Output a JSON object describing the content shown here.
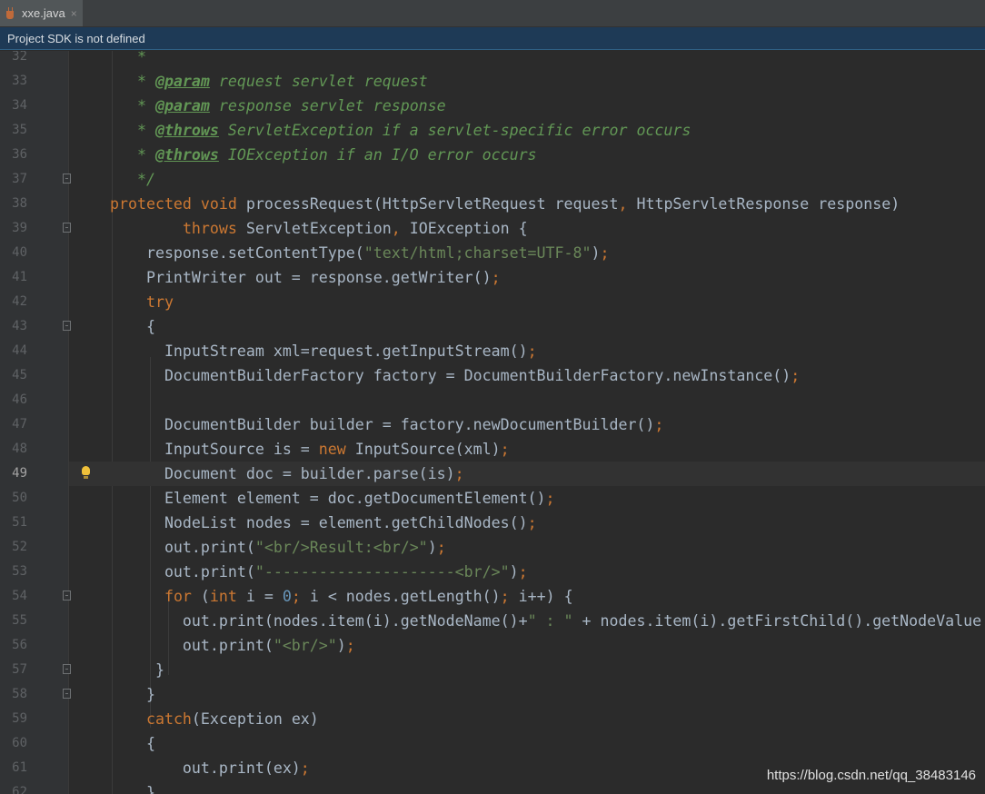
{
  "tab": {
    "filename": "xxe.java",
    "close": "×"
  },
  "notice": "Project SDK is not defined",
  "current_line": 49,
  "watermark": "https://blog.csdn.net/qq_38483146",
  "lines": [
    {
      "n": 32,
      "tokens": [
        [
          "doc",
          "   *"
        ]
      ]
    },
    {
      "n": 33,
      "tokens": [
        [
          "doc",
          "   * "
        ],
        [
          "doctag",
          "@param"
        ],
        [
          "doc",
          " request servlet request"
        ]
      ]
    },
    {
      "n": 34,
      "tokens": [
        [
          "doc",
          "   * "
        ],
        [
          "doctag",
          "@param"
        ],
        [
          "doc",
          " response servlet response"
        ]
      ]
    },
    {
      "n": 35,
      "tokens": [
        [
          "doc",
          "   * "
        ],
        [
          "doctag",
          "@throws"
        ],
        [
          "doc",
          " ServletException if a servlet-specific error occurs"
        ]
      ]
    },
    {
      "n": 36,
      "tokens": [
        [
          "doc",
          "   * "
        ],
        [
          "doctag",
          "@throws"
        ],
        [
          "doc",
          " IOException if an I/O error occurs"
        ]
      ]
    },
    {
      "n": 37,
      "fold": true,
      "tokens": [
        [
          "doc",
          "   */"
        ]
      ]
    },
    {
      "n": 38,
      "tokens": [
        [
          "kw",
          "protected"
        ],
        [
          "",
          " "
        ],
        [
          "kw",
          "void"
        ],
        [
          "",
          " processRequest(HttpServletRequest request"
        ],
        [
          "kw",
          ","
        ],
        [
          "",
          " HttpServletResponse response)"
        ]
      ]
    },
    {
      "n": 39,
      "fold": true,
      "tokens": [
        [
          "",
          "        "
        ],
        [
          "kw",
          "throws"
        ],
        [
          "",
          " ServletException"
        ],
        [
          "kw",
          ","
        ],
        [
          "",
          " IOException {"
        ]
      ]
    },
    {
      "n": 40,
      "tokens": [
        [
          "",
          "    response.setContentType("
        ],
        [
          "str",
          "\"text/html;charset=UTF-8\""
        ],
        [
          "",
          ")"
        ],
        [
          "kw",
          ";"
        ]
      ]
    },
    {
      "n": 41,
      "tokens": [
        [
          "",
          "    PrintWriter out = response.getWriter()"
        ],
        [
          "kw",
          ";"
        ]
      ]
    },
    {
      "n": 42,
      "tokens": [
        [
          "",
          "    "
        ],
        [
          "kw",
          "try"
        ]
      ]
    },
    {
      "n": 43,
      "fold": true,
      "tokens": [
        [
          "",
          "    {"
        ]
      ]
    },
    {
      "n": 44,
      "tokens": [
        [
          "",
          "      InputStream xml=request.getInputStream()"
        ],
        [
          "kw",
          ";"
        ]
      ]
    },
    {
      "n": 45,
      "tokens": [
        [
          "",
          "      DocumentBuilderFactory factory = DocumentBuilderFactory.newInstance()"
        ],
        [
          "kw",
          ";"
        ]
      ]
    },
    {
      "n": 46,
      "tokens": []
    },
    {
      "n": 47,
      "tokens": [
        [
          "",
          "      DocumentBuilder builder = factory.newDocumentBuilder()"
        ],
        [
          "kw",
          ";"
        ]
      ]
    },
    {
      "n": 48,
      "tokens": [
        [
          "",
          "      InputSource is = "
        ],
        [
          "kw",
          "new"
        ],
        [
          "",
          " InputSource(xml)"
        ],
        [
          "kw",
          ";"
        ]
      ]
    },
    {
      "n": 49,
      "bulb": true,
      "tokens": [
        [
          "",
          "      Document doc = builder.parse(is)"
        ],
        [
          "kw",
          ";"
        ]
      ]
    },
    {
      "n": 50,
      "tokens": [
        [
          "",
          "      Element element = doc.getDocumentElement()"
        ],
        [
          "kw",
          ";"
        ]
      ]
    },
    {
      "n": 51,
      "tokens": [
        [
          "",
          "      NodeList nodes = element.getChildNodes()"
        ],
        [
          "kw",
          ";"
        ]
      ]
    },
    {
      "n": 52,
      "tokens": [
        [
          "",
          "      out.print("
        ],
        [
          "str",
          "\"<br/>Result:<br/>\""
        ],
        [
          "",
          ")"
        ],
        [
          "kw",
          ";"
        ]
      ]
    },
    {
      "n": 53,
      "tokens": [
        [
          "",
          "      out.print("
        ],
        [
          "str",
          "\"---------------------<br/>\""
        ],
        [
          "",
          ")"
        ],
        [
          "kw",
          ";"
        ]
      ]
    },
    {
      "n": 54,
      "fold": true,
      "tokens": [
        [
          "",
          "      "
        ],
        [
          "kw",
          "for"
        ],
        [
          "",
          " ("
        ],
        [
          "kw",
          "int"
        ],
        [
          "",
          " i = "
        ],
        [
          "num",
          "0"
        ],
        [
          "kw",
          ";"
        ],
        [
          "",
          " i < nodes.getLength()"
        ],
        [
          "kw",
          ";"
        ],
        [
          "",
          " i++) {"
        ]
      ]
    },
    {
      "n": 55,
      "tokens": [
        [
          "",
          "        out.print(nodes.item(i).getNodeName()+"
        ],
        [
          "str",
          "\" : \""
        ],
        [
          "",
          " + nodes.item(i).getFirstChild().getNodeValue"
        ]
      ]
    },
    {
      "n": 56,
      "tokens": [
        [
          "",
          "        out.print("
        ],
        [
          "str",
          "\"<br/>\""
        ],
        [
          "",
          ")"
        ],
        [
          "kw",
          ";"
        ]
      ]
    },
    {
      "n": 57,
      "fold": true,
      "tokens": [
        [
          "",
          "     }"
        ]
      ]
    },
    {
      "n": 58,
      "fold": true,
      "tokens": [
        [
          "",
          "    }"
        ]
      ]
    },
    {
      "n": 59,
      "tokens": [
        [
          "",
          "    "
        ],
        [
          "kw",
          "catch"
        ],
        [
          "",
          "(Exception ex)"
        ]
      ]
    },
    {
      "n": 60,
      "tokens": [
        [
          "",
          "    {"
        ]
      ]
    },
    {
      "n": 61,
      "tokens": [
        [
          "",
          "        out.print(ex)"
        ],
        [
          "kw",
          ";"
        ]
      ]
    },
    {
      "n": 62,
      "tokens": [
        [
          "",
          "    }"
        ]
      ]
    }
  ]
}
